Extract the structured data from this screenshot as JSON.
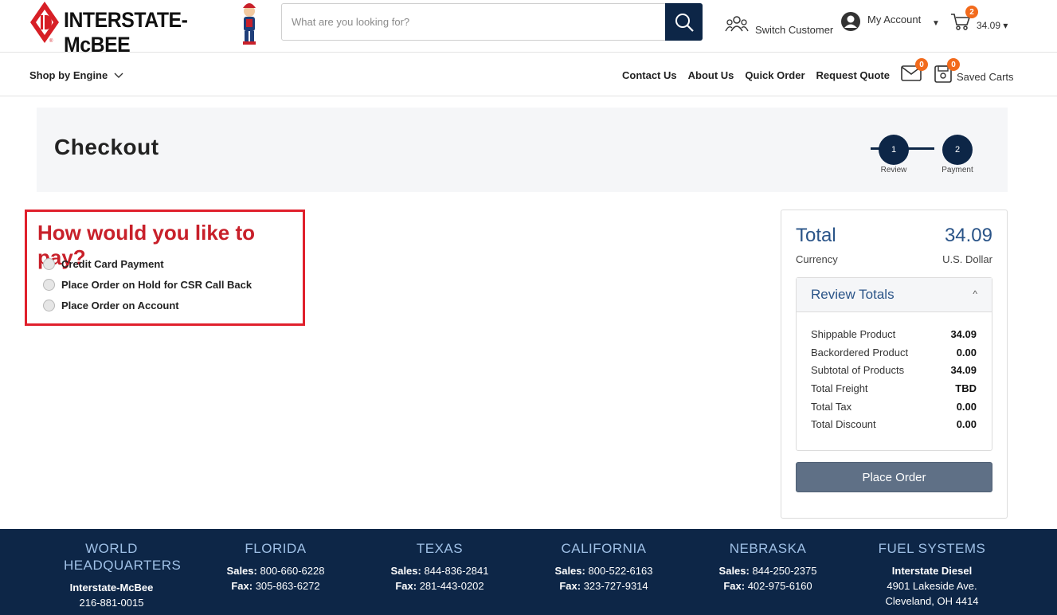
{
  "header": {
    "brand": "INTERSTATE-McBEE",
    "search_placeholder": "What are you looking for?",
    "switch_customer": "Switch Customer",
    "my_account": "My Account",
    "cart_count": "2",
    "cart_total": "34.09"
  },
  "nav": {
    "shop_by_engine": "Shop by Engine",
    "links": [
      "Contact Us",
      "About Us",
      "Quick Order",
      "Request Quote"
    ],
    "mail_count": "0",
    "saved_carts_count": "0",
    "saved_carts": "Saved Carts"
  },
  "checkout": {
    "title": "Checkout",
    "steps": [
      {
        "number": "1",
        "label": "Review"
      },
      {
        "number": "2",
        "label": "Payment"
      }
    ]
  },
  "payment": {
    "question": "How would you like to pay?",
    "options": [
      "Credit Card Payment",
      "Place Order on Hold for CSR Call Back",
      "Place Order on Account"
    ]
  },
  "totals": {
    "total_label": "Total",
    "total_value": "34.09",
    "currency_label": "Currency",
    "currency_value": "U.S. Dollar",
    "review_title": "Review Totals",
    "rows": [
      {
        "label": "Shippable Product",
        "value": "34.09"
      },
      {
        "label": "Backordered Product",
        "value": "0.00"
      },
      {
        "label": "Subtotal of Products",
        "value": "34.09"
      },
      {
        "label": "Total Freight",
        "value": "TBD"
      },
      {
        "label": "Total Tax",
        "value": "0.00"
      },
      {
        "label": "Total Discount",
        "value": "0.00"
      }
    ],
    "place_order": "Place Order"
  },
  "footer": {
    "columns": [
      {
        "title": "WORLD HEADQUARTERS",
        "line1_label": "",
        "line1": "Interstate-McBee",
        "line2_label": "",
        "line2": "216-881-0015"
      },
      {
        "title": "FLORIDA",
        "line1_label": "Sales:",
        "line1": "800-660-6228",
        "line2_label": "Fax:",
        "line2": "305-863-6272"
      },
      {
        "title": "TEXAS",
        "line1_label": "Sales:",
        "line1": "844-836-2841",
        "line2_label": "Fax:",
        "line2": "281-443-0202"
      },
      {
        "title": "CALIFORNIA",
        "line1_label": "Sales:",
        "line1": "800-522-6163",
        "line2_label": "Fax:",
        "line2": "323-727-9314"
      },
      {
        "title": "NEBRASKA",
        "line1_label": "Sales:",
        "line1": "844-250-2375",
        "line2_label": "Fax:",
        "line2": "402-975-6160"
      },
      {
        "title": "FUEL SYSTEMS",
        "line1_label": "",
        "line1": "Interstate Diesel",
        "line2_label": "",
        "line2": "4901 Lakeside Ave.",
        "line3": "Cleveland, OH 4414"
      }
    ]
  },
  "colors": {
    "navy": "#0d2647",
    "accent_red": "#c8202a",
    "badge_orange": "#f26a1b",
    "link_blue": "#2a5488"
  }
}
